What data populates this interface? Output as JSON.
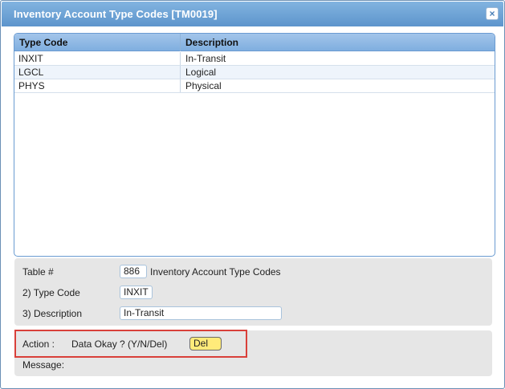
{
  "window": {
    "title": "Inventory Account Type Codes [TM0019]",
    "close_symbol": "×"
  },
  "grid": {
    "columns": [
      "Type Code",
      "Description"
    ],
    "rows": [
      {
        "code": "INXIT",
        "description": "In-Transit"
      },
      {
        "code": "LGCL",
        "description": "Logical"
      },
      {
        "code": "PHYS",
        "description": "Physical"
      }
    ]
  },
  "form": {
    "table_label": "Table #",
    "table_number": "886",
    "table_name": "Inventory Account Type Codes",
    "type_code_label": "2) Type Code",
    "type_code_value": "INXIT",
    "description_label": "3) Description",
    "description_value": "In-Transit"
  },
  "action": {
    "label": "Action :",
    "prompt": "Data Okay ? (Y/N/Del)",
    "value": "Del",
    "message_label": "Message:"
  },
  "colors": {
    "title_bar": "#5d95cc",
    "highlight_border": "#d9403a",
    "action_input_bg": "#ffeb7a"
  }
}
